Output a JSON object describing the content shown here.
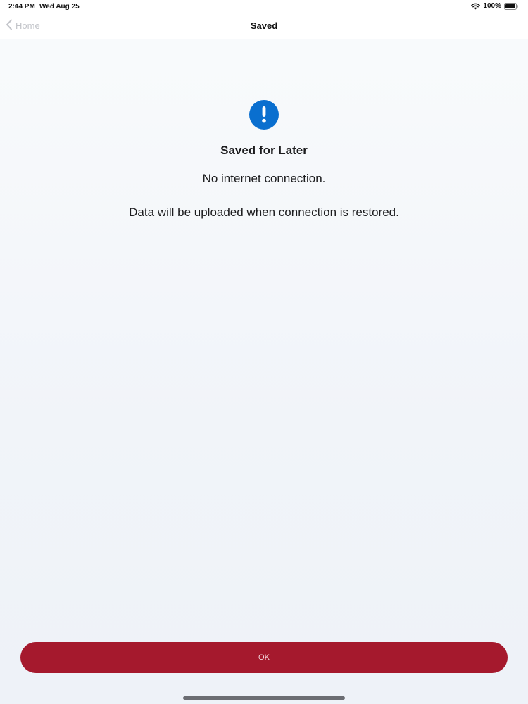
{
  "status_bar": {
    "time": "2:44 PM",
    "date": "Wed Aug 25",
    "battery": "100%",
    "icons": [
      "wifi-icon",
      "battery-icon"
    ]
  },
  "nav": {
    "back_label": "Home",
    "back_icon": "chevron-left-icon",
    "title": "Saved"
  },
  "message": {
    "icon": "exclamation-circle-icon",
    "icon_color": "#0a6fcf",
    "title": "Saved for Later",
    "line1": "No internet connection.",
    "line2": "Data will be uploaded when connection is restored."
  },
  "actions": {
    "ok_label": "OK",
    "ok_color": "#a5192d"
  }
}
